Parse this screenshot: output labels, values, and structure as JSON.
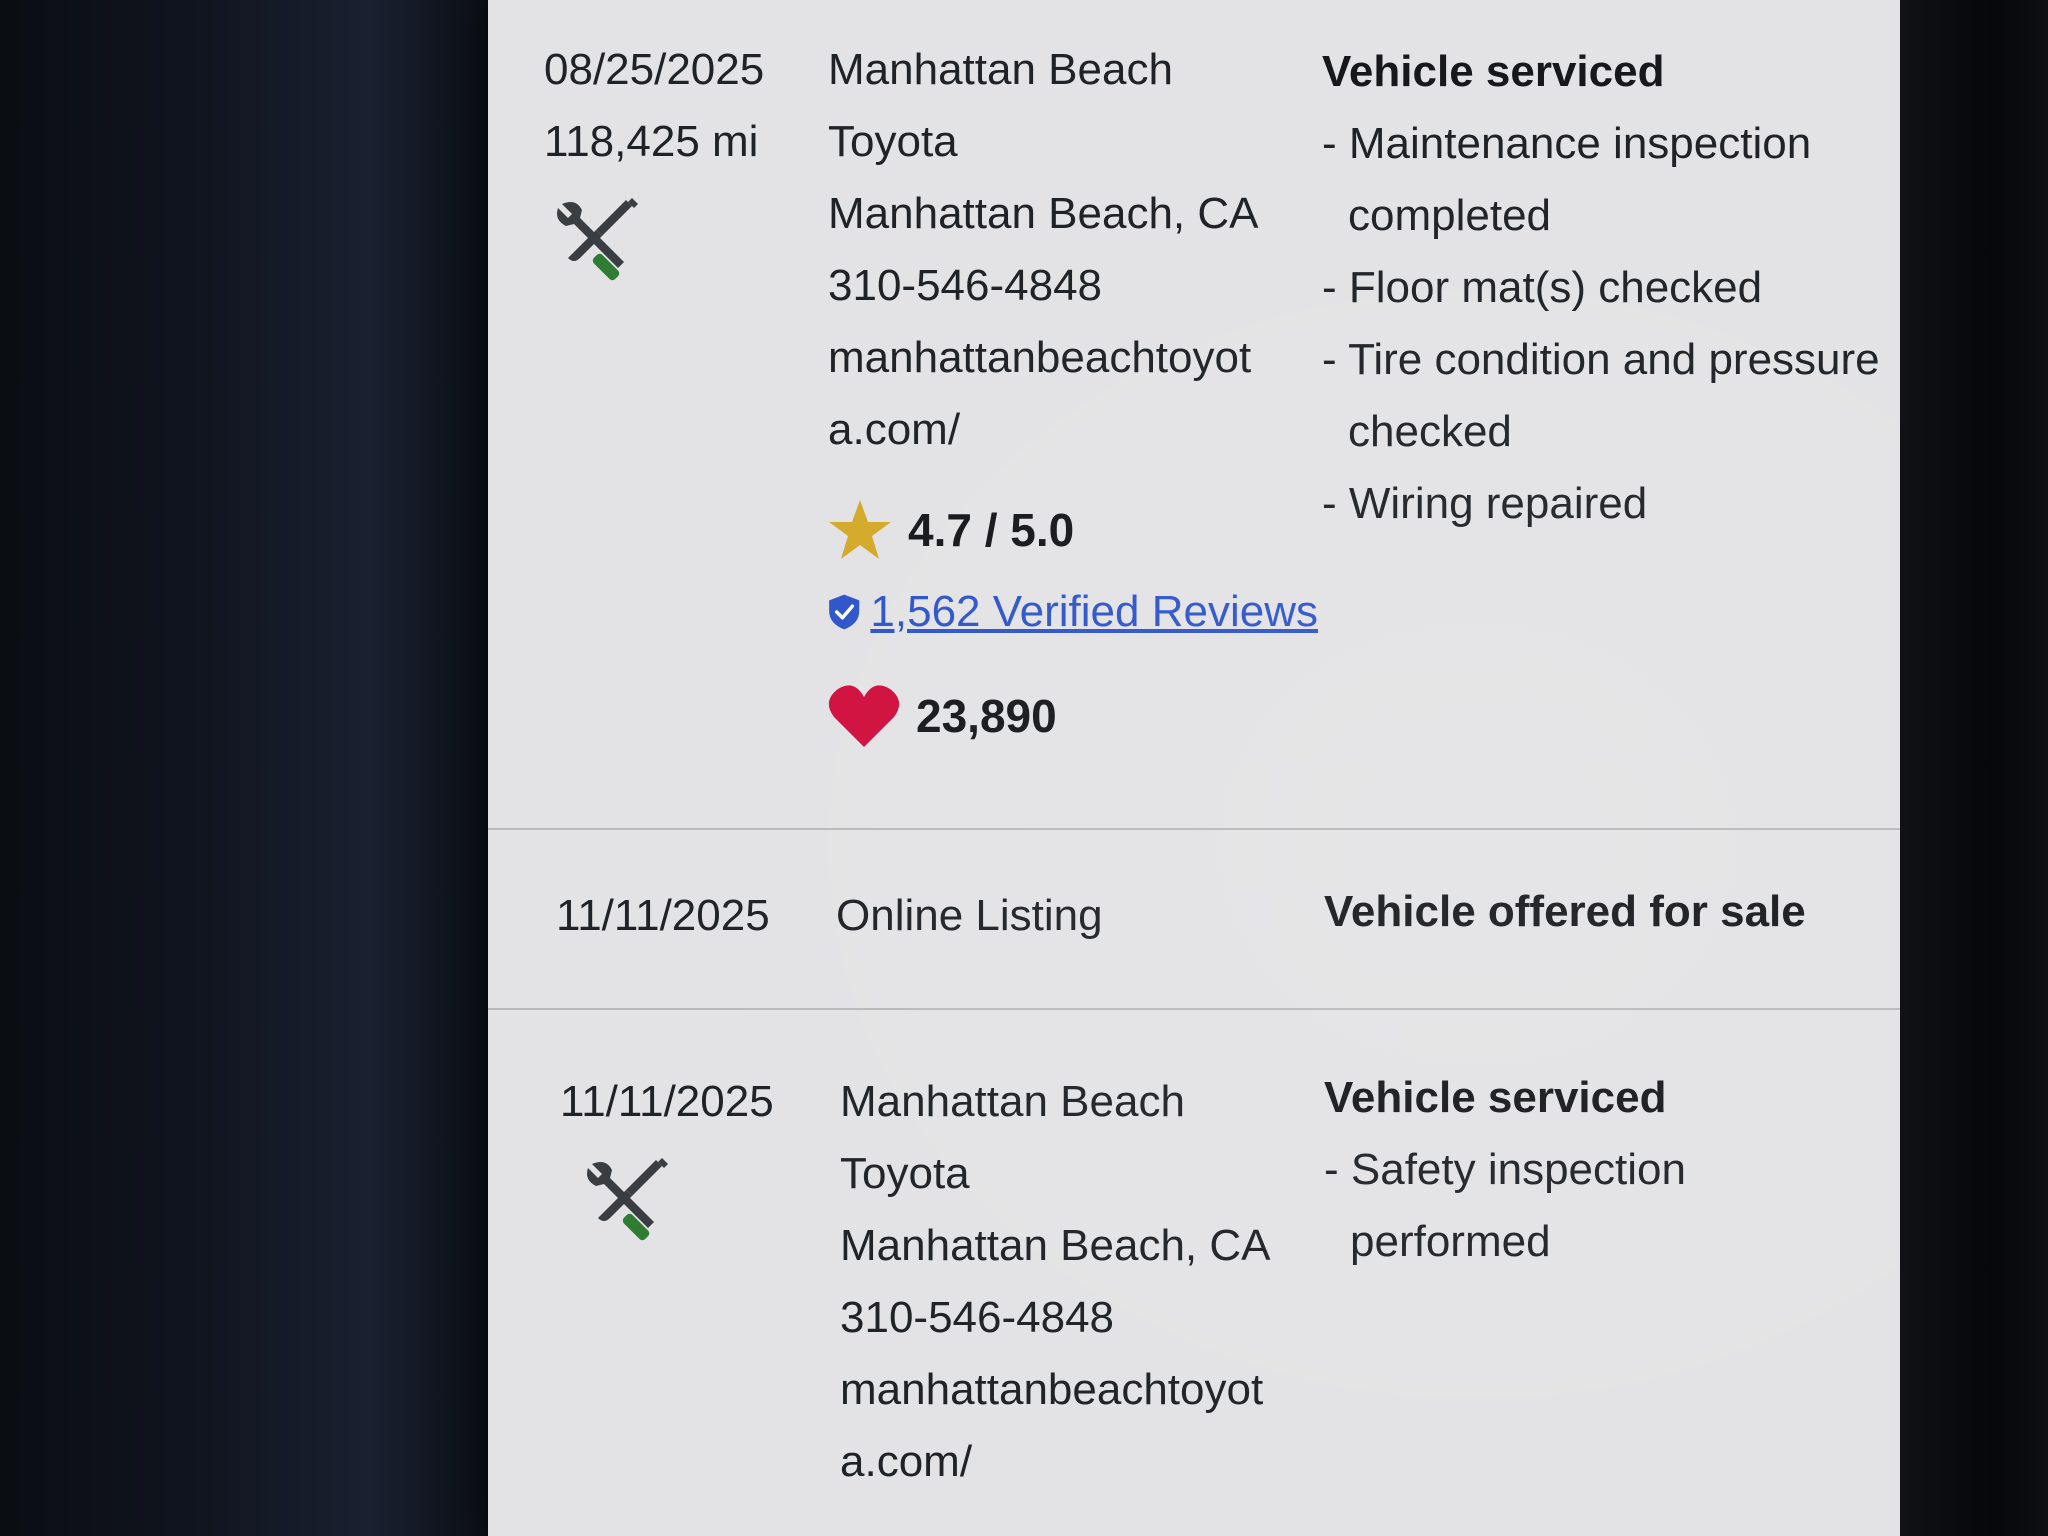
{
  "records": [
    {
      "date": "08/25/2025",
      "mileage": "118,425 mi",
      "icon": "service-tools-icon",
      "source_lines": [
        "Manhattan Beach",
        "Toyota",
        "Manhattan Beach, CA",
        "310-546-4848",
        "manhattanbeachtoyot",
        "a.com/"
      ],
      "rating": "4.7 / 5.0",
      "reviews": "1,562 Verified Reviews",
      "likes": "23,890",
      "heading": "Vehicle serviced",
      "details": [
        "- Maintenance inspection completed",
        "- Floor mat(s) checked",
        "- Tire condition and pressure checked",
        "- Wiring repaired"
      ]
    },
    {
      "date": "11/11/2025",
      "source_lines": [
        "Online Listing"
      ],
      "heading": "Vehicle offered for sale"
    },
    {
      "date": "11/11/2025",
      "icon": "service-tools-icon",
      "source_lines": [
        "Manhattan Beach",
        "Toyota",
        "Manhattan Beach, CA",
        "310-546-4848",
        "manhattanbeachtoyot",
        "a.com/"
      ],
      "heading": "Vehicle serviced",
      "details": [
        "- Safety inspection performed"
      ]
    }
  ],
  "colors": {
    "star": "#d4a92a",
    "shield": "#2f55c9",
    "heart": "#d0103f",
    "tool_handle": "#2e7d32",
    "tool_metal": "#3a3d42",
    "link": "#2f55c9"
  }
}
